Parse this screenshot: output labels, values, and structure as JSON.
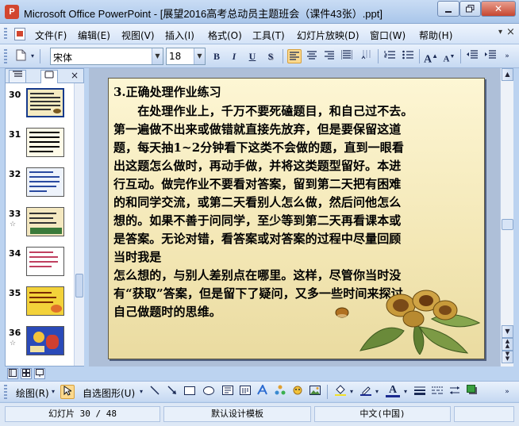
{
  "window": {
    "title": "Microsoft Office PowerPoint - [展望2016高考总动员主题班会（课件43张）.ppt]",
    "app_icon": "P",
    "controls": {
      "minimize": "0",
      "maximize": "□",
      "close": "✕"
    }
  },
  "menu": {
    "items": [
      "文件(F)",
      "编辑(E)",
      "视图(V)",
      "插入(I)",
      "格式(O)",
      "工具(T)",
      "幻灯片放映(D)",
      "窗口(W)",
      "帮助(H)"
    ],
    "close_glyph": "×"
  },
  "format_toolbar": {
    "font_name": "宋体",
    "font_size": "18",
    "bold": "B",
    "italic": "I",
    "underline": "U",
    "shadow": "S"
  },
  "slides_panel": {
    "close_glyph": "×",
    "slides": [
      {
        "number": "30",
        "has_transition_icon": false,
        "selected": true
      },
      {
        "number": "31",
        "has_transition_icon": false,
        "selected": false
      },
      {
        "number": "32",
        "has_transition_icon": false,
        "selected": false
      },
      {
        "number": "33",
        "has_transition_icon": true,
        "selected": false
      },
      {
        "number": "34",
        "has_transition_icon": false,
        "selected": false
      },
      {
        "number": "35",
        "has_transition_icon": false,
        "selected": false
      },
      {
        "number": "36",
        "has_transition_icon": true,
        "selected": false
      }
    ],
    "transition_glyph": "☆"
  },
  "slide": {
    "heading": "3.正确处理作业练习",
    "lines": [
      "　　在处理作业上，千万不要死磕题目，和自己过不去。",
      "第一遍做不出来或做错就直接先放弃，但是要保留这道",
      "题，每天抽1~2分钟看下这类不会做的题，直到一眼看",
      "出这题怎么做时，再动手做，并将这类题型留好。本进",
      "行互动。做完作业不要看对答案，留到第二天把有困难",
      "的和同学交流，或第二天看别人怎么做，然后问他怎么",
      "想的。如果不善于问同学，至少等到第二天再看课本或",
      "是答案。无论对错，看答案或对答案的过程中尽量回顾",
      "当时我是",
      "怎么想的，与别人差别点在哪里。这样，尽管你当时没",
      "有“获取”答案，但是留下了疑问，又多一些时间来探讨",
      "自己做题时的思维。"
    ]
  },
  "drawing_toolbar": {
    "draw_label": "绘图(R)",
    "autoshapes_label": "自选图形(U)"
  },
  "status": {
    "slide_position": "幻灯片 30 / 48",
    "template": "默认设计模板",
    "language": "中文(中国)"
  },
  "colors": {
    "title_bar": "#a9c6ea",
    "slide_background": "#f3e7b5",
    "selected_thumb_border": "#163a8c"
  }
}
